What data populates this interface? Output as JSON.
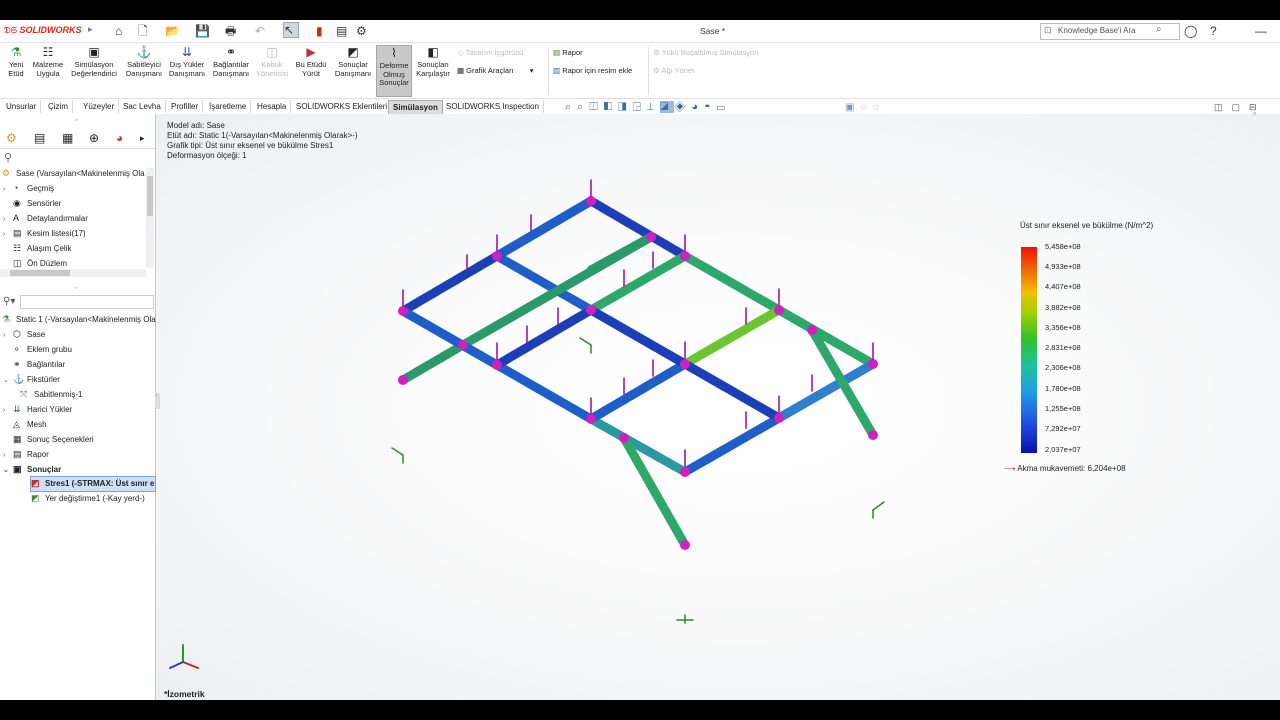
{
  "app": {
    "logo": "SOLIDWORKS",
    "doc_title": "Sase *",
    "search_placeholder": "Knowledge Base'i Ara"
  },
  "ribbon": {
    "buttons": [
      {
        "label": "Yeni Etüd",
        "icon": "study-icon"
      },
      {
        "label": "Malzeme Uygula",
        "icon": "material-icon"
      },
      {
        "label": "Simülasyon Değerlendirici",
        "icon": "evaluator-icon"
      },
      {
        "label": "Sabitleyici Danışmanı",
        "icon": "fixture-icon"
      },
      {
        "label": "Dış Yükler Danışmanı",
        "icon": "load-icon"
      },
      {
        "label": "Bağlantılar Danışmanı",
        "icon": "connection-icon"
      },
      {
        "label": "Kabuk Yöneticisi",
        "icon": "shell-icon"
      },
      {
        "label": "Bu Etüdü Yürüt",
        "icon": "run-icon"
      },
      {
        "label": "Sonuçlar Danışmanı",
        "icon": "results-icon"
      },
      {
        "label": "Deforme Olmuş Sonuçlar",
        "icon": "deformed-icon"
      },
      {
        "label": "Sonuçları Karşılaştır",
        "icon": "compare-icon"
      }
    ],
    "small_buttons": {
      "design_insight": "Tasarım İçgörüsü",
      "plot_tools": "Grafik Araçları",
      "report": "Rapor",
      "add_image": "Rapor için resim ekle",
      "load_sim": "Yükü Boşaltılmış Simülasyon",
      "manage_network": "Ağı Yönet"
    }
  },
  "tabs": [
    "Unsurlar",
    "Çizim",
    "Yüzeyler",
    "Sac Levha",
    "Profiller",
    "İşaretleme",
    "Hesapla",
    "SOLIDWORKS Eklentileri",
    "Simülasyon",
    "SOLIDWORKS Inspection"
  ],
  "active_tab": "Simülasyon",
  "feature_tree": {
    "root": "Sase  (Varsayılan<Makinelenmiş Ola",
    "items": [
      "Geçmiş",
      "Sensörler",
      "Detaylandırmalar",
      "Kesim listesi(17)",
      "Alaşım Çelik",
      "Ön Düzlem"
    ]
  },
  "sim_tree": {
    "root": "Static 1 (-Varsayılan<Makinelenmiş Ola",
    "items": [
      "Sase",
      "Eklem grubu",
      "Bağlantılar",
      "Fikstürler",
      "Sabitlenmiş-1",
      "Harici Yükler",
      "Mesh",
      "Sonuç Seçenekleri",
      "Rapor",
      "Sonuçlar",
      "Stres1 (-STRMAX: Üst sınır e",
      "Yer değiştirme1 (-Kay yerd-)"
    ]
  },
  "study_info": {
    "model": "Model adı: Sase",
    "study": "Etüt adı: Static 1(-Varsayılan<Makinelenmiş Olarak>-)",
    "plot": "Grafik tipi: Üst sınır eksenel ve bükülme Stres1",
    "scale": "Deformasyon ölçeği: 1"
  },
  "legend": {
    "title": "Üst sınır eksenel ve bükülme (N/m^2)",
    "values": [
      "5,458e+08",
      "4,933e+08",
      "4,407e+08",
      "3,882e+08",
      "3,356e+08",
      "2,831e+08",
      "2,306e+08",
      "1,780e+08",
      "1,255e+08",
      "7,292e+07",
      "2,037e+07"
    ],
    "yield": "Akma mukavemeti: 6,204e+08"
  },
  "view_label": "*İzometrik",
  "colors": {
    "accent": "#d52b1e",
    "tab_active": "#dcdcdc",
    "pink_joint": "#d020c0",
    "arrow": "#a0179c"
  }
}
